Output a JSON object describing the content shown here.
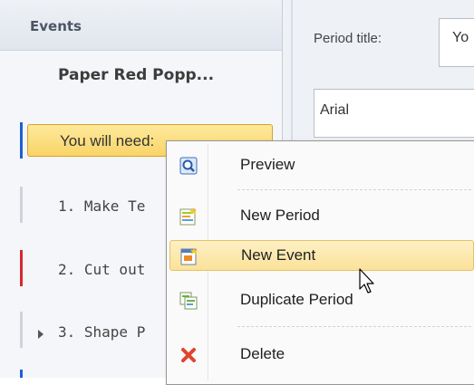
{
  "sidebar": {
    "title": "Events",
    "period_title": "Paper Red Popp...",
    "selected_item": "You will need:",
    "items": [
      {
        "label": "1. Make Te",
        "marker_color": "#cfd3d8"
      },
      {
        "label": "2. Cut out",
        "marker_color": "#d9272e"
      },
      {
        "label": "3. Shape P",
        "marker_color": "#cfd3d8"
      }
    ],
    "selected_marker_color": "#1f5fd6"
  },
  "properties": {
    "period_title_label": "Period title:",
    "period_title_value": "Yo",
    "font_value": "Arial"
  },
  "context_menu": {
    "items": [
      {
        "label": "Preview",
        "icon": "preview-icon"
      },
      {
        "label": "New Period",
        "icon": "new-period-icon"
      },
      {
        "label": "New Event",
        "icon": "new-event-icon",
        "highlighted": true
      },
      {
        "label": "Duplicate Period",
        "icon": "duplicate-period-icon"
      },
      {
        "label": "Delete",
        "icon": "delete-icon"
      }
    ]
  },
  "colors": {
    "highlight": "#fbe29a",
    "accent_blue": "#1f5fd6",
    "accent_red": "#d9272e"
  }
}
